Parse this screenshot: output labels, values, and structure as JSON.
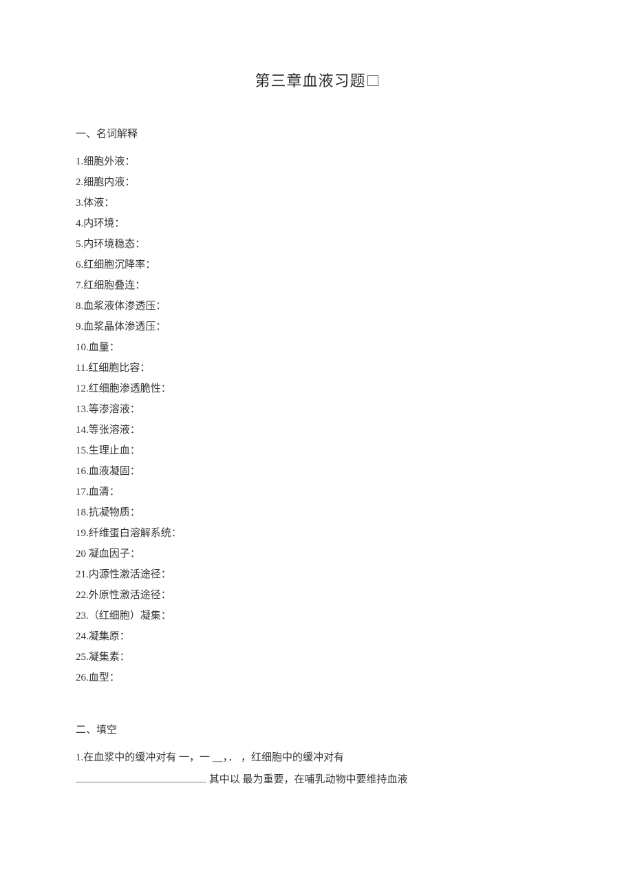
{
  "title_main": "第三章血液习题",
  "section1_heading": "一、名词解释",
  "terms": [
    "1.细胞外液：",
    "2.细胞内液：",
    "3.体液：",
    "4.内环境：",
    "5.内环境稳态：",
    "6.红细胞沉降率：",
    "7.红细胞叠连：",
    "8.血浆液体渗透压：",
    "9.血浆晶体渗透压：",
    "10.血量：",
    "11.红细胞比容：",
    "12.红细胞渗透脆性：",
    "13.等渗溶液：",
    "14.等张溶液：",
    "15.生理止血：",
    "16.血液凝固：",
    "17.血清：",
    "18.抗凝物质：",
    "19.纤维蛋白溶解系统：",
    "20 凝血因子：",
    "21.内源性激活途径：",
    "22.外原性激活途径：",
    "23.（红细胞）凝集：",
    "24.凝集原：",
    "25.凝集素：",
    "26.血型："
  ],
  "section2_heading": "二、填空",
  "fill_q1_part1": "1.在血浆中的缓冲对有 一，一 ＿，． ",
  "fill_q1_part2": "，红细胞中的缓冲对有",
  "fill_q1_part3": " 其中以 最为重要，在哺乳动物中要维持血液"
}
